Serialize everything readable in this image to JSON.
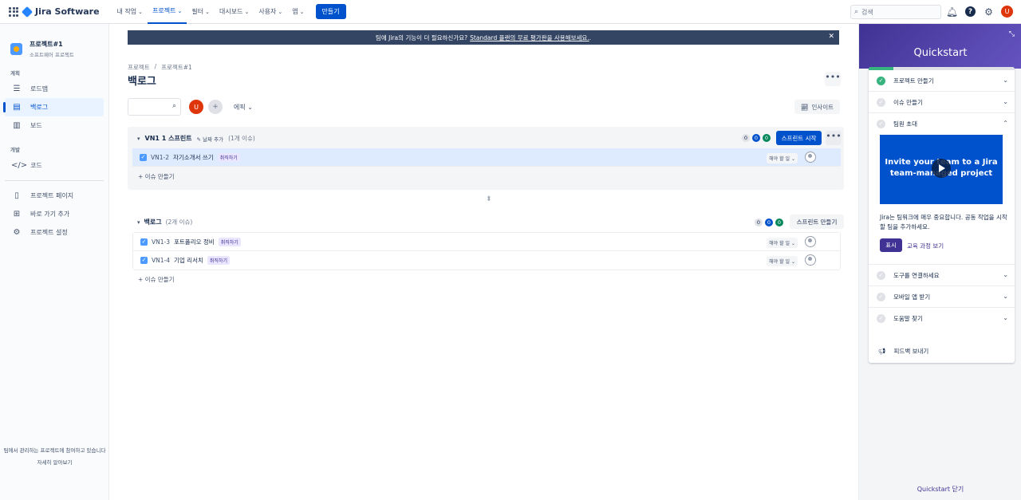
{
  "topnav": {
    "app_name": "Jira Software",
    "items": [
      {
        "label": "내 작업",
        "active": false
      },
      {
        "label": "프로젝트",
        "active": true
      },
      {
        "label": "필터",
        "active": false
      },
      {
        "label": "대시보드",
        "active": false
      },
      {
        "label": "사용자",
        "active": false
      },
      {
        "label": "앱",
        "active": false
      }
    ],
    "create_label": "만들기",
    "search_placeholder": "검색",
    "avatar_initial": "U"
  },
  "sidebar": {
    "project_name": "프로젝트#1",
    "project_type": "소프트웨어 프로젝트",
    "planning_label": "계획",
    "planning_items": [
      {
        "label": "로드맵",
        "icon": "roadmap-icon"
      },
      {
        "label": "백로그",
        "icon": "backlog-icon",
        "active": true
      },
      {
        "label": "보드",
        "icon": "board-icon"
      }
    ],
    "dev_label": "개발",
    "dev_items": [
      {
        "label": "코드",
        "icon": "code-icon"
      }
    ],
    "other_items": [
      {
        "label": "프로젝트 페이지",
        "icon": "page-icon"
      },
      {
        "label": "바로 가기 추가",
        "icon": "shortcut-icon"
      },
      {
        "label": "프로젝트 설정",
        "icon": "settings-icon"
      }
    ],
    "footer_text": "팀에서 관리하는 프로젝트에 참여하고 있습니다",
    "footer_link": "자세히 알아보기"
  },
  "banner": {
    "text": "팀에 Jira의 기능이 더 필요하신가요?",
    "link": "Standard 플랜의 무료 평가판을 사용해보세요.",
    "suffix": "."
  },
  "breadcrumb": {
    "root": "프로젝트",
    "sep": "/",
    "project": "프로젝트#1"
  },
  "page_title": "백로그",
  "toolbar": {
    "avatar_initial": "U",
    "epic_label": "에픽",
    "insight_label": "인사이트"
  },
  "sprint": {
    "name": "VN1 1 스프린트",
    "add_date": "날짜 추가",
    "issue_count": "(1개 이슈)",
    "counts": [
      "0",
      "0",
      "0"
    ],
    "start_label": "스프린트 시작",
    "issues": [
      {
        "key": "VN1-2",
        "summary": "자기소개서 쓰기",
        "label": "취직하기",
        "status": "해야 할 일"
      }
    ],
    "create_issue": "+ 이슈 만들기"
  },
  "backlog": {
    "name": "백로그",
    "issue_count": "(2개 이슈)",
    "counts": [
      "0",
      "0",
      "0"
    ],
    "create_sprint": "스프린트 만들기",
    "issues": [
      {
        "key": "VN1-3",
        "summary": "포트폴리오 정비",
        "label": "취직하기",
        "status": "해야 할 일"
      },
      {
        "key": "VN1-4",
        "summary": "기업 리서치",
        "label": "취직하기",
        "status": "해야 할 일"
      }
    ],
    "create_issue": "+ 이슈 만들기"
  },
  "quickstart": {
    "title": "Quickstart",
    "progress": 0.17,
    "items_top": [
      {
        "label": "프로젝트 만들기",
        "done": true
      },
      {
        "label": "이슈 만들기",
        "done": false
      },
      {
        "label": "팀원 초대",
        "done": false
      }
    ],
    "video_text": "Invite your team to a Jira team-managed project",
    "description": "Jira는 팀워크에 매우 중요합니다. 공동 작업을 시작할 팀을 추가하세요.",
    "show_label": "표시",
    "learn_label": "교육 과정 보기",
    "items_bottom": [
      {
        "label": "도구를 연결하세요",
        "done": false
      },
      {
        "label": "모바일 앱 받기",
        "done": false
      },
      {
        "label": "도움말 찾기",
        "done": false
      }
    ],
    "feedback_label": "피드백 보내기",
    "close_label": "Quickstart 닫기"
  }
}
